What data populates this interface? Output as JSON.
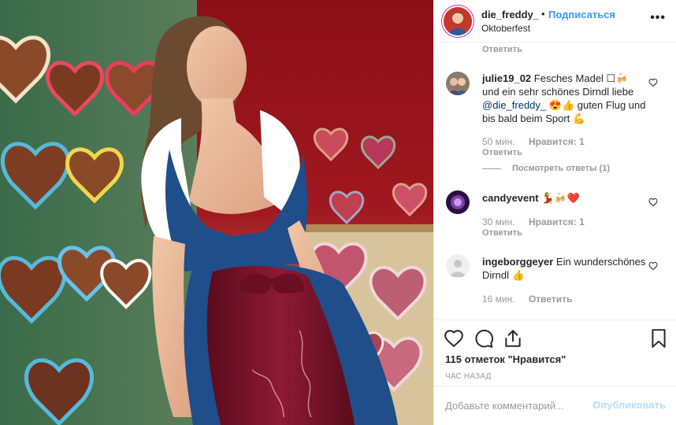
{
  "post": {
    "username": "die_freddy_",
    "separator": "•",
    "follow_label": "Подписаться",
    "location": "Oktoberfest",
    "more_label": "•••"
  },
  "comments": {
    "reply_label": "Ответить",
    "items": [
      {
        "username": "julie19_02",
        "text_a": "Fesches Madel ☐🍻 und ein sehr schönes Dirndl liebe ",
        "mention": "@die_freddy_",
        "text_b": " 😍👍 guten Flug und bis bald beim Sport 💪",
        "time": "50 мин.",
        "likes": "Нравится: 1",
        "reply": "Ответить",
        "view_replies": "Посмотреть ответы (1)"
      },
      {
        "username": "candyevent",
        "text": "💃🍻❤️",
        "time": "30 мин.",
        "likes": "Нравится: 1",
        "reply": "Ответить"
      },
      {
        "username": "ingeborggeyer",
        "text": "Ein wunderschönes Dirndl 👍",
        "time": "16 мин.",
        "reply": "Ответить"
      }
    ]
  },
  "stats": {
    "likes": "115 отметок \"Нравится\"",
    "time": "ЧАС НАЗАД"
  },
  "composer": {
    "placeholder": "Добавьте комментарий...",
    "post_label": "Опубликовать"
  },
  "colors": {
    "link": "#3897f0",
    "muted": "#999999",
    "text": "#262626",
    "post_disabled": "#b2dffc"
  },
  "icons": [
    "heart-icon",
    "comment-icon",
    "share-icon",
    "bookmark-icon",
    "more-icon"
  ]
}
